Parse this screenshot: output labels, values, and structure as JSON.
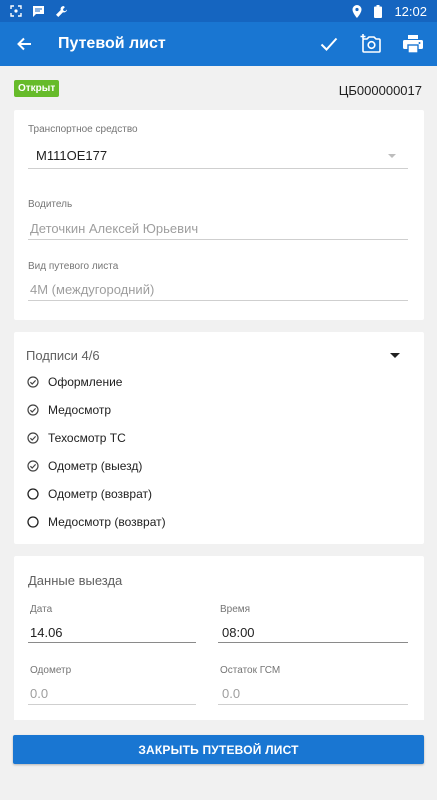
{
  "status_bar": {
    "time": "12:02",
    "icons": [
      "screenshot-icon",
      "message-icon",
      "wrench-icon",
      "location-icon",
      "battery-icon"
    ]
  },
  "app_bar": {
    "title": "Путевой лист",
    "actions": [
      "check-icon",
      "camera-add-icon",
      "print-icon"
    ]
  },
  "document": {
    "status_badge": "Открыт",
    "number": "ЦБ000000017"
  },
  "vehicle_card": {
    "vehicle_label": "Транспортное средство",
    "vehicle_value": "М111ОЕ177",
    "driver_label": "Водитель",
    "driver_value": "Деточкин Алексей Юрьевич",
    "type_label": "Вид путевого листа",
    "type_value": "4М (междугородний)"
  },
  "signatures": {
    "title": "Подписи 4/6",
    "items": [
      {
        "label": "Оформление",
        "done": true
      },
      {
        "label": "Медосмотр",
        "done": true
      },
      {
        "label": "Техосмотр ТС",
        "done": true
      },
      {
        "label": "Одометр (выезд)",
        "done": true
      },
      {
        "label": "Одометр (возврат)",
        "done": false
      },
      {
        "label": "Медосмотр (возврат)",
        "done": false
      }
    ]
  },
  "departure": {
    "title": "Данные выезда",
    "date_label": "Дата",
    "date_value": "14.06",
    "time_label": "Время",
    "time_value": "08:00",
    "odometer_label": "Одометр",
    "odometer_placeholder": "0.0",
    "fuel_label": "Остаток ГСМ",
    "fuel_placeholder": "0.0"
  },
  "actions": {
    "close_button": "ЗАКРЫТЬ ПУТЕВОЙ ЛИСТ"
  },
  "colors": {
    "status_bar": "#1565c0",
    "app_bar": "#1976d2",
    "badge": "#66bb2a",
    "button": "#1976d2"
  }
}
